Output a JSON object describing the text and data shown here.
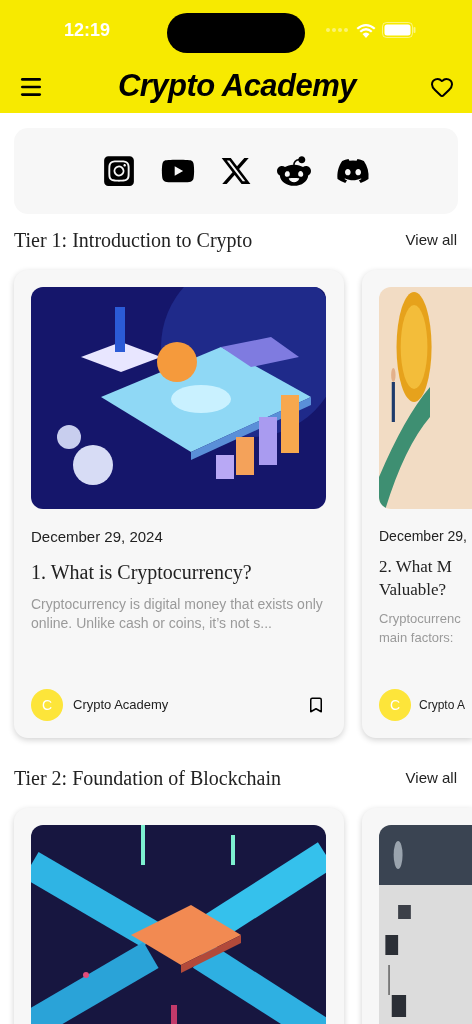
{
  "status_bar": {
    "time": "12:19"
  },
  "header": {
    "title": "Crypto Academy"
  },
  "social_links": [
    {
      "kind": "instagram"
    },
    {
      "kind": "youtube"
    },
    {
      "kind": "x"
    },
    {
      "kind": "reddit"
    },
    {
      "kind": "discord"
    }
  ],
  "sections": [
    {
      "title": "Tier 1: Introduction to Crypto",
      "view_all": "View all",
      "cards": [
        {
          "kind": "full",
          "date": "December 29, 2024",
          "title": "1. What is Cryptocurrency?",
          "excerpt": "Cryptocurrency is digital money that exists only online. Unlike cash or coins, it’s not s...",
          "avatar": "C",
          "author": "Crypto Academy",
          "bookmarked": false
        },
        {
          "kind": "partial",
          "date": "December 29,",
          "title_lines": [
            "2. What M",
            "Valuable?"
          ],
          "excerpt_lines": [
            "Cryptocurrenc",
            "main factors:"
          ],
          "avatar": "C",
          "author": "Crypto A"
        }
      ]
    },
    {
      "title": "Tier 2: Foundation of Blockchain",
      "view_all": "View all",
      "cards": [
        {
          "kind": "image_only"
        },
        {
          "kind": "image_only"
        }
      ]
    }
  ]
}
